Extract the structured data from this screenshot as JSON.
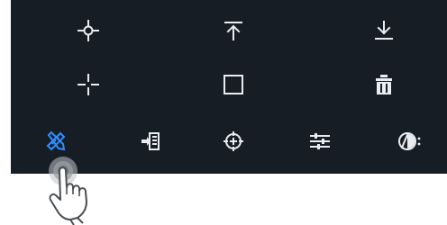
{
  "colors": {
    "toolbar_bg": "#161d25",
    "icon": "#e9edf1",
    "active_icon": "#2f8fff",
    "page_bg": "#ffffff"
  },
  "toolbar": {
    "rows": [
      [
        "crosshair-plus-icon",
        "align-top-icon",
        "download-icon"
      ],
      [
        "crosshair-gap-icon",
        "square-icon",
        "trash-icon"
      ],
      [
        "ruler-pencil-icon",
        "import-icon",
        "target-icon",
        "sliders-icon",
        "rotate-icon"
      ]
    ],
    "active_item": "ruler-pencil-icon"
  },
  "gesture_hint": "tap-hand-icon"
}
